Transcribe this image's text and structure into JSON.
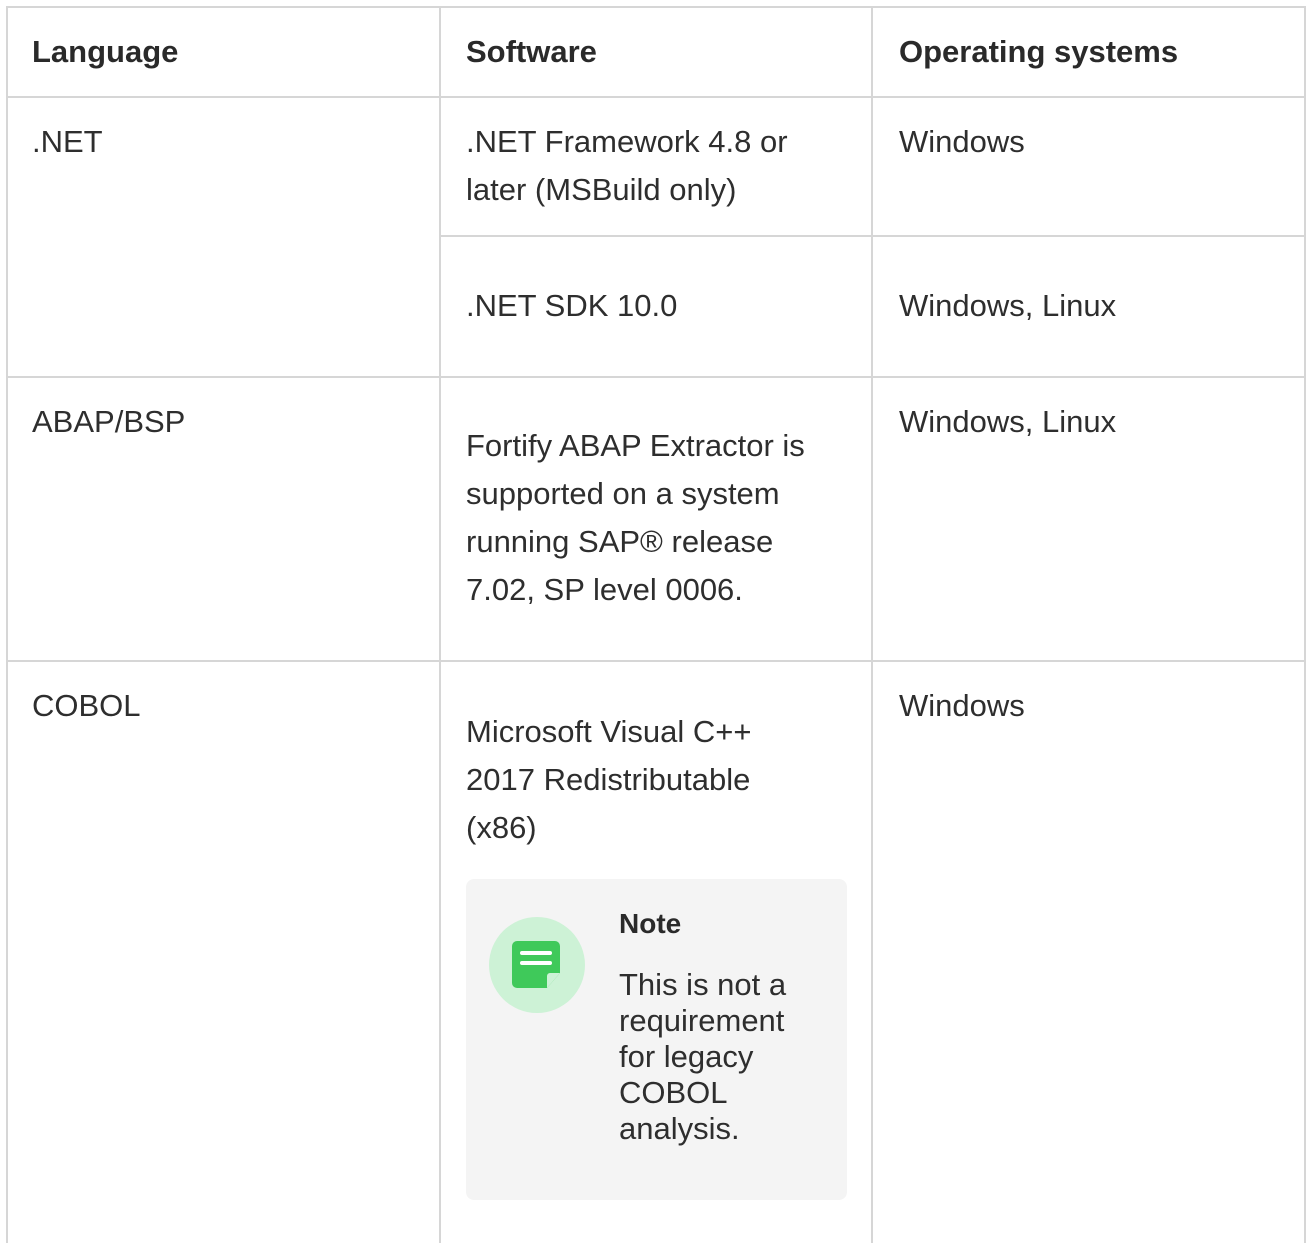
{
  "table": {
    "headers": {
      "language": "Language",
      "software": "Software",
      "os": "Operating systems"
    },
    "rows": [
      {
        "language": ".NET",
        "entries": [
          {
            "software_lines": [
              ".NET Framework 4.8 or",
              "later (MSBuild only)"
            ],
            "os": "Windows"
          },
          {
            "software_lines": [
              ".NET SDK 10.0"
            ],
            "os": "Windows, Linux"
          }
        ]
      },
      {
        "language": "ABAP/BSP",
        "entries": [
          {
            "software_lines": [
              "Fortify ABAP Extractor is",
              "supported on a system",
              "running SAP® release",
              "7.02, SP level 0006."
            ],
            "os": "Windows, Linux"
          }
        ]
      },
      {
        "language": "COBOL",
        "entries": [
          {
            "software_lines": [
              "Microsoft Visual C++",
              "2017 Redistributable",
              "(x86)"
            ],
            "os": "Windows"
          }
        ],
        "note": {
          "title": "Note",
          "body_lines": [
            "This is not a",
            "requirement",
            "for legacy",
            "COBOL",
            "analysis."
          ],
          "icon": "note-icon",
          "icon_color": "#3fc95a",
          "icon_bg": "#cdf2d6"
        }
      }
    ]
  },
  "colors": {
    "grid": "#d6d6d6",
    "note_bg": "#f4f4f4"
  }
}
